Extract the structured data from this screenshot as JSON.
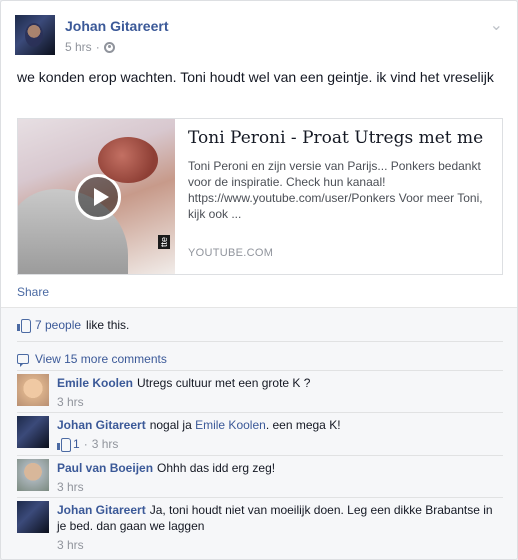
{
  "post": {
    "author": "Johan Gitareert",
    "time": "5 hrs",
    "privacy_icon": "globe-icon",
    "text": "we konden erop wachten. Toni houdt wel van een geintje. ik vind het vreselijk"
  },
  "attachment": {
    "title": "Toni Peroni - Proat Utregs met me",
    "description": "Toni Peroni en zijn versie van Parijs... Ponkers bedankt voor de inspiratie. Check hun kanaal! https://www.youtube.com/user/Ponkers Voor meer Toni, kijk ook ...",
    "domain": "YOUTUBE.COM",
    "badge": "tte"
  },
  "actions": {
    "share": "Share"
  },
  "likes": {
    "count_text": "7 people",
    "suffix": "like this."
  },
  "comments_more": "View 15 more comments",
  "comments": [
    {
      "name": "Emile Koolen",
      "text": "Utregs cultuur met een grote K ?",
      "time": "3 hrs"
    },
    {
      "name": "Johan Gitareert",
      "text_before": "nogal ja",
      "mention": "Emile Koolen",
      "text_after": ". een mega K!",
      "likes": "1",
      "time": "3 hrs"
    },
    {
      "name": "Paul van Boeijen",
      "text": "Ohhh das idd erg zeg!",
      "time": "3 hrs"
    },
    {
      "name": "Johan Gitareert",
      "text": "Ja, toni houdt niet van moeilijk doen. Leg een dikke Brabantse in je bed. dan gaan we laggen",
      "time": "3 hrs"
    }
  ],
  "colors": {
    "link": "#3b5998",
    "meta": "#90949c",
    "ufi_bg": "#f6f7f9"
  }
}
